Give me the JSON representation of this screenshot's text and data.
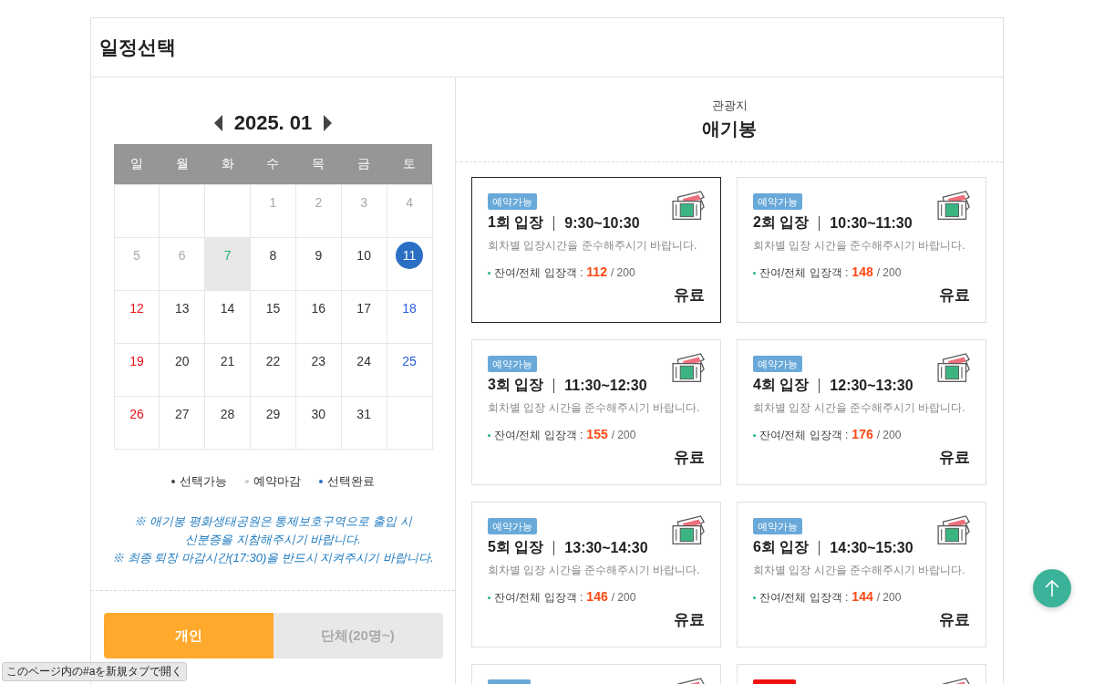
{
  "page_title": "일정선택",
  "calendar": {
    "month": "2025. 01",
    "weekdays": [
      "일",
      "월",
      "화",
      "수",
      "목",
      "금",
      "토"
    ],
    "weeks": [
      [
        {
          "day": "1",
          "closed": true,
          "today": false,
          "selected": false
        },
        {
          "day": "2",
          "closed": true,
          "today": false,
          "selected": false
        },
        {
          "day": "3",
          "closed": true,
          "today": false,
          "selected": false
        },
        {
          "day": "4",
          "closed": true,
          "today": false,
          "selected": false
        }
      ],
      [
        {
          "day": "5",
          "closed": true,
          "today": false,
          "selected": false
        },
        {
          "day": "6",
          "closed": true,
          "today": false,
          "selected": false
        },
        {
          "day": "7",
          "closed": false,
          "today": true,
          "selected": false
        },
        {
          "day": "8",
          "closed": false,
          "today": false,
          "selected": false
        },
        {
          "day": "9",
          "closed": false,
          "today": false,
          "selected": false
        },
        {
          "day": "10",
          "closed": false,
          "today": false,
          "selected": false
        },
        {
          "day": "11",
          "closed": false,
          "today": false,
          "selected": true
        }
      ],
      [
        {
          "day": "12",
          "closed": false,
          "today": false,
          "selected": false
        },
        {
          "day": "13",
          "closed": false,
          "today": false,
          "selected": false
        },
        {
          "day": "14",
          "closed": false,
          "today": false,
          "selected": false
        },
        {
          "day": "15",
          "closed": false,
          "today": false,
          "selected": false
        },
        {
          "day": "16",
          "closed": false,
          "today": false,
          "selected": false
        },
        {
          "day": "17",
          "closed": false,
          "today": false,
          "selected": false
        },
        {
          "day": "18",
          "closed": false,
          "today": false,
          "selected": false
        }
      ],
      [
        {
          "day": "19",
          "closed": false,
          "today": false,
          "selected": false
        },
        {
          "day": "20",
          "closed": false,
          "today": false,
          "selected": false
        },
        {
          "day": "21",
          "closed": false,
          "today": false,
          "selected": false
        },
        {
          "day": "22",
          "closed": false,
          "today": false,
          "selected": false
        },
        {
          "day": "23",
          "closed": false,
          "today": false,
          "selected": false
        },
        {
          "day": "24",
          "closed": false,
          "today": false,
          "selected": false
        },
        {
          "day": "25",
          "closed": false,
          "today": false,
          "selected": false
        }
      ],
      [
        {
          "day": "26",
          "closed": false,
          "today": false,
          "selected": false
        },
        {
          "day": "27",
          "closed": false,
          "today": false,
          "selected": false
        },
        {
          "day": "28",
          "closed": false,
          "today": false,
          "selected": false
        },
        {
          "day": "29",
          "closed": false,
          "today": false,
          "selected": false
        },
        {
          "day": "30",
          "closed": false,
          "today": false,
          "selected": false
        },
        {
          "day": "31",
          "closed": false,
          "today": false,
          "selected": false
        }
      ]
    ]
  },
  "legend": [
    {
      "label": "선택가능",
      "color": "#444444"
    },
    {
      "label": "예약마감",
      "color": "#cccccc"
    },
    {
      "label": "선택완료",
      "color": "#2a6fc4"
    }
  ],
  "notice": [
    "※ 애기봉 평화생태공원은 통제보호구역으로 출입 시",
    "신분증을 지참해주시기 바랍니다.",
    "※ 최종 퇴장 마감시간(17:30)을 반드시 지켜주시기 바랍니다."
  ],
  "visitor_tabs": [
    {
      "label": "개인",
      "selected": true
    },
    {
      "label": "단체(20명~)",
      "selected": false
    }
  ],
  "place": {
    "category": "관광지",
    "name": "애기봉"
  },
  "sessions": [
    {
      "badge": {
        "label": "예약가능",
        "color": "#69a9d9"
      },
      "title": "1회 입장",
      "time": "9:30~10:30",
      "note": "회차별 입장시간을 준수해주시기 바랍니다.",
      "count_label": "잔여/전체 입장객 :",
      "remaining": "112",
      "total": "/ 200",
      "fee": "유료",
      "selected": true
    },
    {
      "badge": {
        "label": "예약가능",
        "color": "#69a9d9"
      },
      "title": "2회 입장",
      "time": "10:30~11:30",
      "note": "회차별 입장 시간을 준수해주시기 바랍니다.",
      "count_label": "잔여/전체 입장객 :",
      "remaining": "148",
      "total": "/ 200",
      "fee": "유료",
      "selected": false
    },
    {
      "badge": {
        "label": "예약가능",
        "color": "#69a9d9"
      },
      "title": "3회 입장",
      "time": "11:30~12:30",
      "note": "회차별 입장 시간을 준수해주시기 바랍니다.",
      "count_label": "잔여/전체 입장객 :",
      "remaining": "155",
      "total": "/ 200",
      "fee": "유료",
      "selected": false
    },
    {
      "badge": {
        "label": "예약가능",
        "color": "#69a9d9"
      },
      "title": "4회 입장",
      "time": "12:30~13:30",
      "note": "회차별 입장 시간을 준수해주시기 바랍니다.",
      "count_label": "잔여/전체 입장객 :",
      "remaining": "176",
      "total": "/ 200",
      "fee": "유료",
      "selected": false
    },
    {
      "badge": {
        "label": "예약가능",
        "color": "#69a9d9"
      },
      "title": "5회 입장",
      "time": "13:30~14:30",
      "note": "회차별 입장 시간을 준수해주시기 바랍니다.",
      "count_label": "잔여/전체 입장객 :",
      "remaining": "146",
      "total": "/ 200",
      "fee": "유료",
      "selected": false
    },
    {
      "badge": {
        "label": "예약가능",
        "color": "#69a9d9"
      },
      "title": "6회 입장",
      "time": "14:30~15:30",
      "note": "회차별 입장 시간을 준수해주시기 바랍니다.",
      "count_label": "잔여/전체 입장객 :",
      "remaining": "144",
      "total": "/ 200",
      "fee": "유료",
      "selected": false
    },
    {
      "badge": {
        "color": "#69a9d9"
      },
      "selected": false
    },
    {
      "badge": {
        "color": "#ee1111"
      },
      "selected": false
    }
  ],
  "status_bar": "このページ内の#aを新規タブで開く"
}
